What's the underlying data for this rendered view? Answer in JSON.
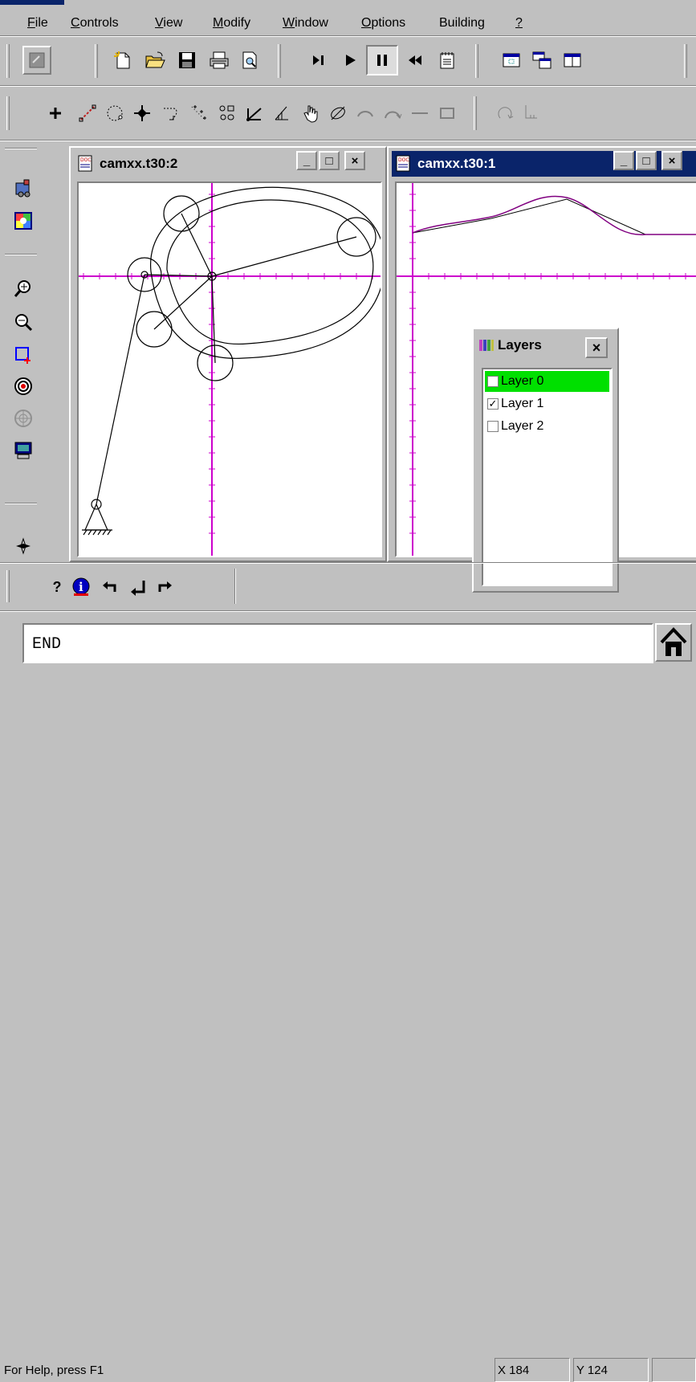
{
  "menu": {
    "items": [
      {
        "label": "File",
        "ul": "F",
        "rest": "ile"
      },
      {
        "label": "Controls",
        "ul": "C",
        "rest": "ontrols"
      },
      {
        "label": "View",
        "ul": "V",
        "rest": "iew"
      },
      {
        "label": "Modify",
        "ul": "M",
        "rest": "odify"
      },
      {
        "label": "Window",
        "ul": "W",
        "rest": "indow"
      },
      {
        "label": "Options",
        "ul": "O",
        "rest": "ptions"
      },
      {
        "label": "Building",
        "ul": "",
        "rest": "Building"
      },
      {
        "label": "?",
        "ul": "?",
        "rest": ""
      }
    ]
  },
  "toolbar1": {
    "icons": [
      "gray-square-icon",
      "new-file-icon",
      "open-folder-icon",
      "save-disk-icon",
      "print-icon",
      "print-preview-icon",
      "step-forward-icon",
      "play-icon",
      "pause-icon",
      "rewind-icon",
      "notepad-icon",
      "window-single-icon",
      "window-cascade-icon",
      "window-tile-icon"
    ]
  },
  "toolbar2": {
    "icons": [
      "plus-icon",
      "line-icon",
      "circle-icon",
      "point-icon",
      "arc-arrow-icon",
      "scatter-icon",
      "symbols-icon",
      "axes-icon",
      "angle-icon",
      "hand-icon",
      "eraser-icon",
      "arc-icon",
      "arc2-icon",
      "dash-icon",
      "rectangle-icon",
      "rotate-icon",
      "foot-icon"
    ]
  },
  "left_toolbar": {
    "icons": [
      "engine-icon",
      "color-palette-icon",
      "zoom-in-icon",
      "zoom-out-icon",
      "zoom-window-icon",
      "target-icon",
      "gear-grid-icon",
      "monitor-icon",
      "compass-icon"
    ]
  },
  "bottom_toolbar": {
    "icons": [
      "help-question-icon",
      "info-icon",
      "undo-arrow-icon",
      "return-arrow-icon",
      "redo-arrow-icon"
    ],
    "help_label": "?"
  },
  "windows": [
    {
      "title": "camxx.t30:2",
      "active": false
    },
    {
      "title": "camxx.t30:1",
      "active": true
    }
  ],
  "window_controls": {
    "minimize": "_",
    "maximize": "□",
    "close": "×"
  },
  "layers": {
    "title": "Layers",
    "close": "×",
    "rows": [
      {
        "label": "Layer 0",
        "checked": false,
        "selected": true,
        "mark": ""
      },
      {
        "label": "Layer 1",
        "checked": true,
        "selected": false,
        "mark": "✓"
      },
      {
        "label": "Layer 2",
        "checked": false,
        "selected": false,
        "mark": ""
      }
    ]
  },
  "command": {
    "value": "END"
  },
  "status": {
    "help": "For Help, press F1",
    "x": "X 184",
    "y": "Y 124"
  },
  "colors": {
    "axis": "#cc00cc",
    "title_active": "#0a246a",
    "selected_layer": "#00e000",
    "face": "#c0c0c0"
  }
}
